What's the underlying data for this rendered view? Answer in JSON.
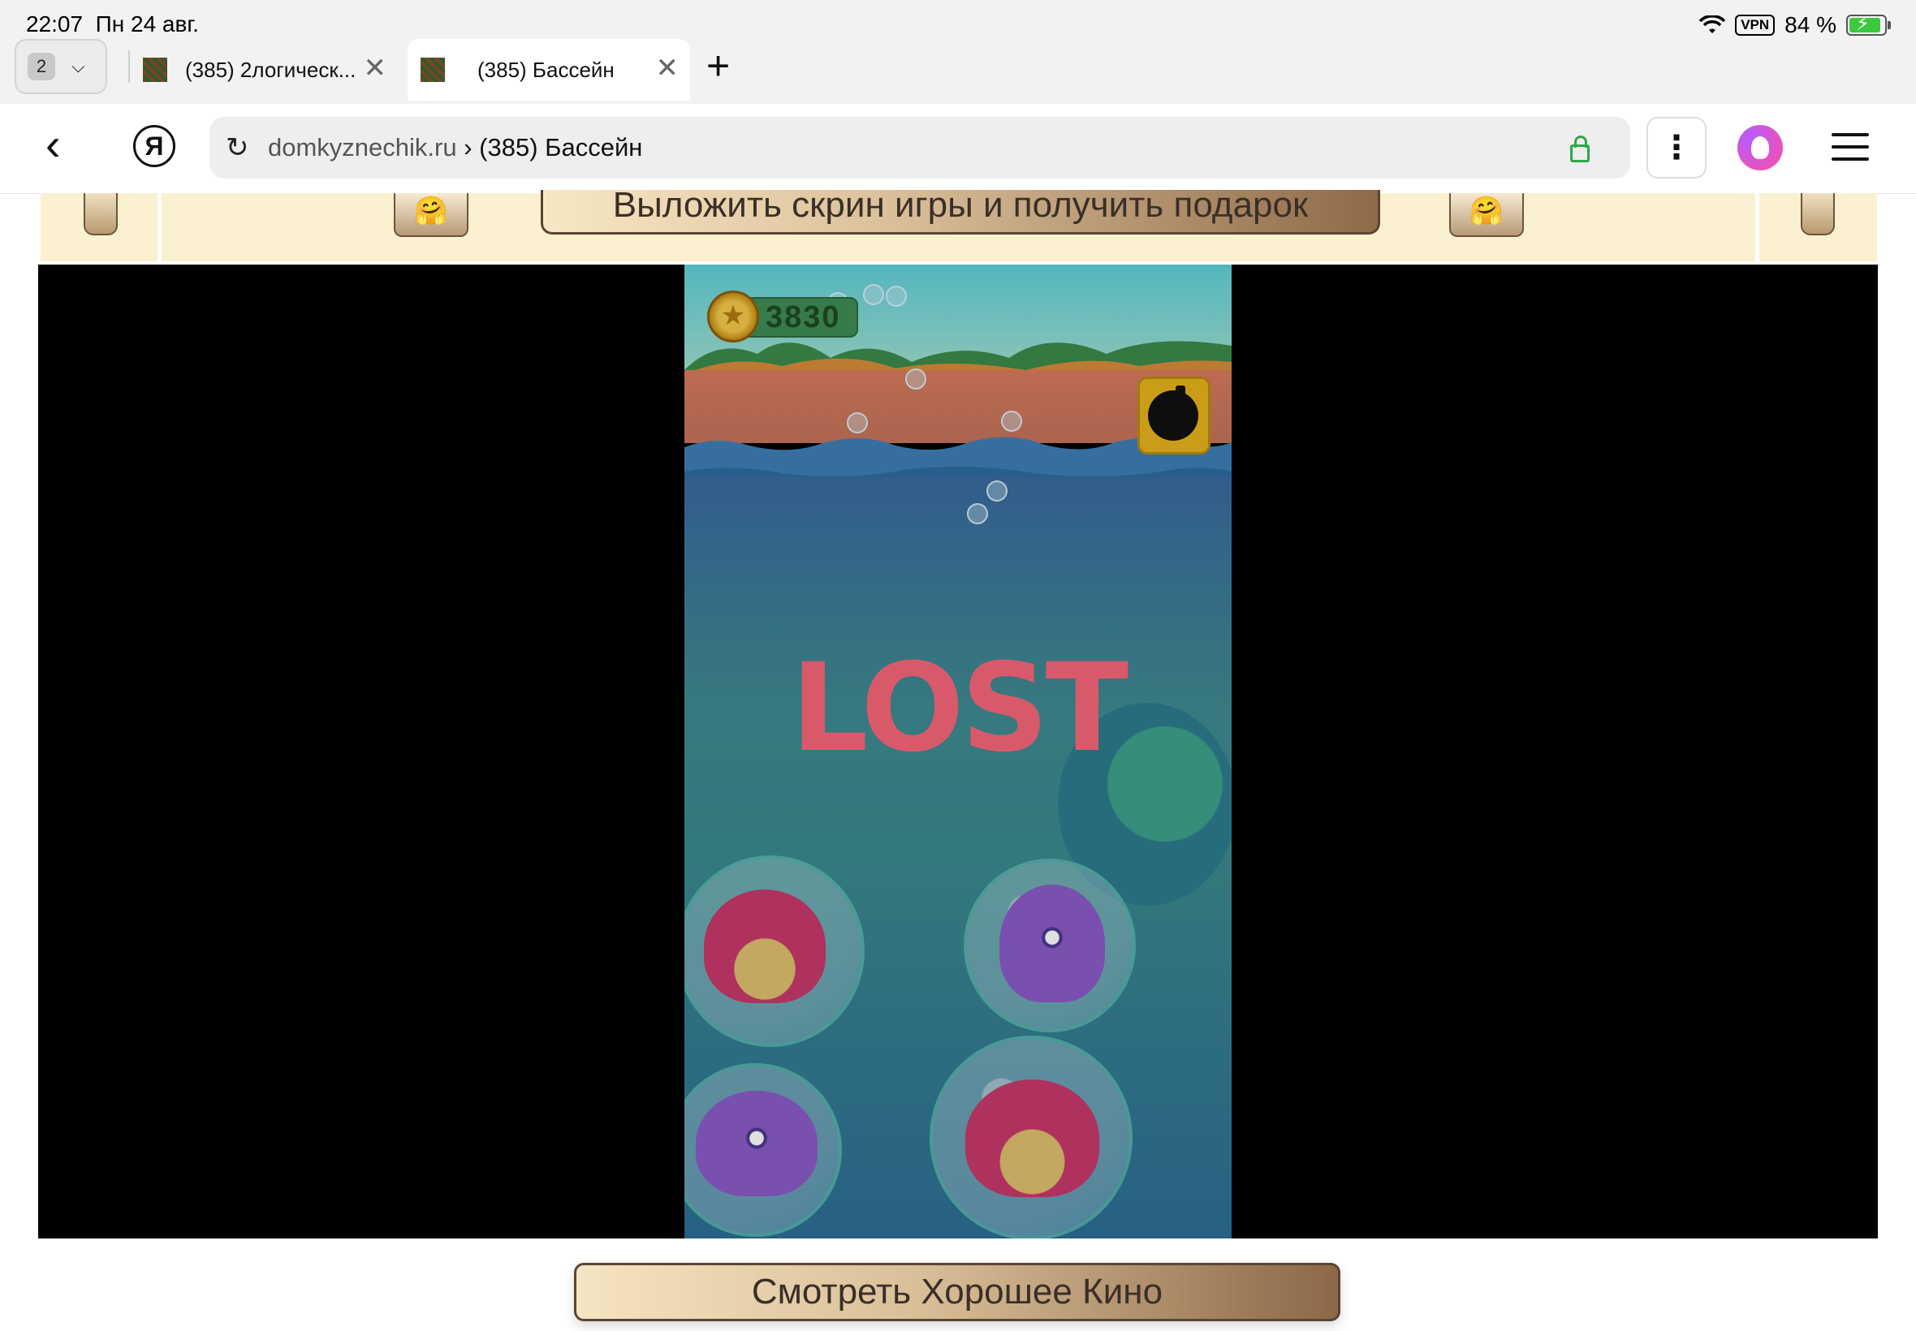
{
  "status_bar": {
    "time": "22:07",
    "date": "Пн 24 авг.",
    "vpn": "VPN",
    "battery": "84 %"
  },
  "tabs": {
    "count": "2",
    "items": [
      {
        "label": "(385) 2логическ..."
      },
      {
        "label": "(385) Бассейн"
      }
    ]
  },
  "address_bar": {
    "domain": "domkyznechik.ru",
    "separator": "›",
    "page_title": "(385) Бассейн"
  },
  "banner": {
    "promo_label": "Выложить скрин игры и получить подарок",
    "emoji": "🤗"
  },
  "game": {
    "score": "3830",
    "status_text": "LOST"
  },
  "footer": {
    "movie_button": "Смотреть Хорошее Кино"
  },
  "colors": {
    "banner_bg": "#fbf0cf",
    "lost_text": "#d85a6a",
    "lock_green": "#2ea84a"
  }
}
